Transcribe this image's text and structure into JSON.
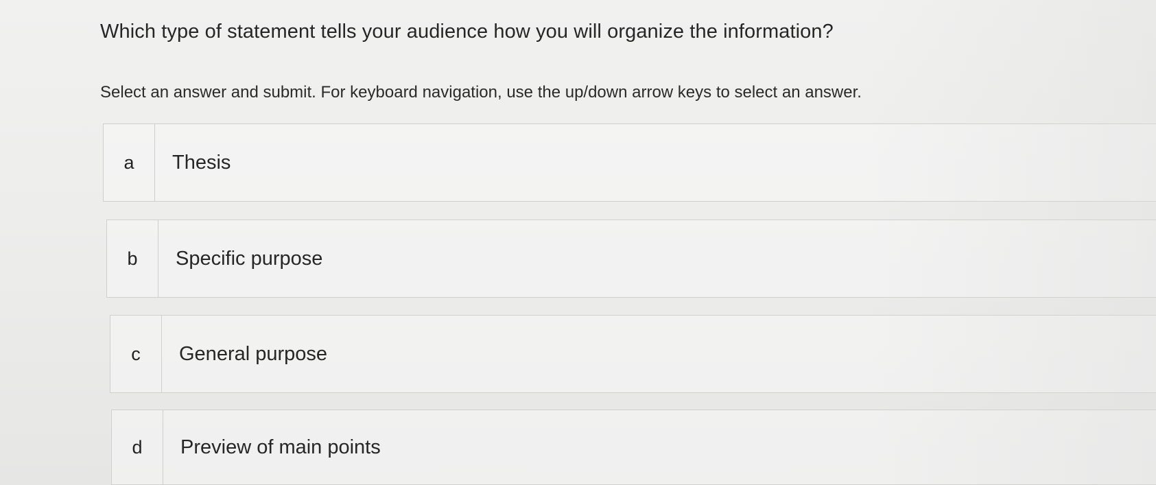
{
  "question": {
    "text": "Which type of statement tells your audience how you will organize the information?"
  },
  "instructions": {
    "text": "Select an answer and submit. For keyboard navigation, use the up/down arrow keys to select an answer."
  },
  "options": [
    {
      "letter": "a",
      "label": "Thesis"
    },
    {
      "letter": "b",
      "label": "Specific purpose"
    },
    {
      "letter": "c",
      "label": "General purpose"
    },
    {
      "letter": "d",
      "label": "Preview of main points"
    }
  ]
}
